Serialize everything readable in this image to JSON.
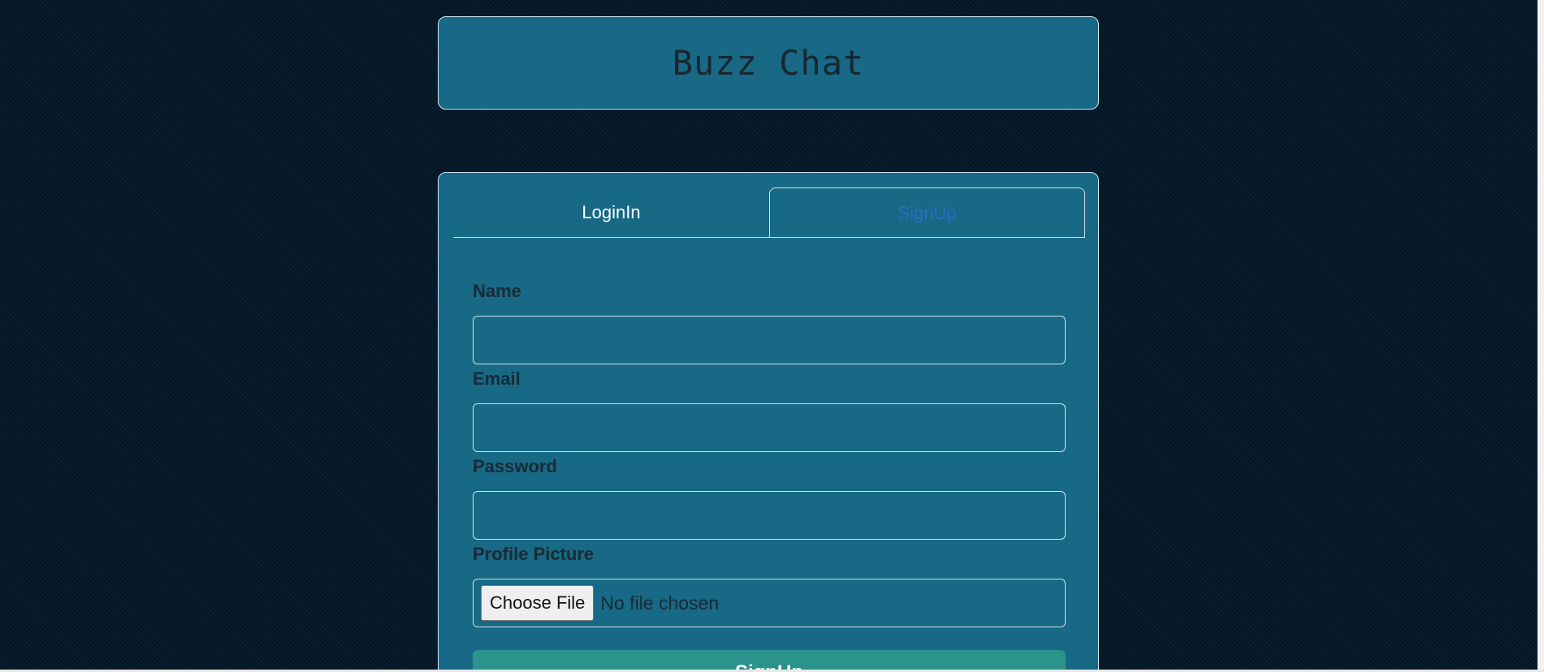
{
  "app": {
    "title": "Buzz Chat"
  },
  "tabs": [
    {
      "label": "LoginIn",
      "active": false
    },
    {
      "label": "SignUp",
      "active": true
    }
  ],
  "form": {
    "name_label": "Name",
    "name_value": "",
    "email_label": "Email",
    "email_value": "",
    "password_label": "Password",
    "password_value": "",
    "picture_label": "Profile Picture",
    "choose_file_label": "Choose File",
    "file_status": "No file chosen",
    "submit_label": "SignUp"
  },
  "colors": {
    "background": "#04192a",
    "panel": "#176985",
    "panel_border": "#cfe3ea",
    "active_tab_text": "#2b6cc4",
    "submit_button": "#2a948c"
  }
}
